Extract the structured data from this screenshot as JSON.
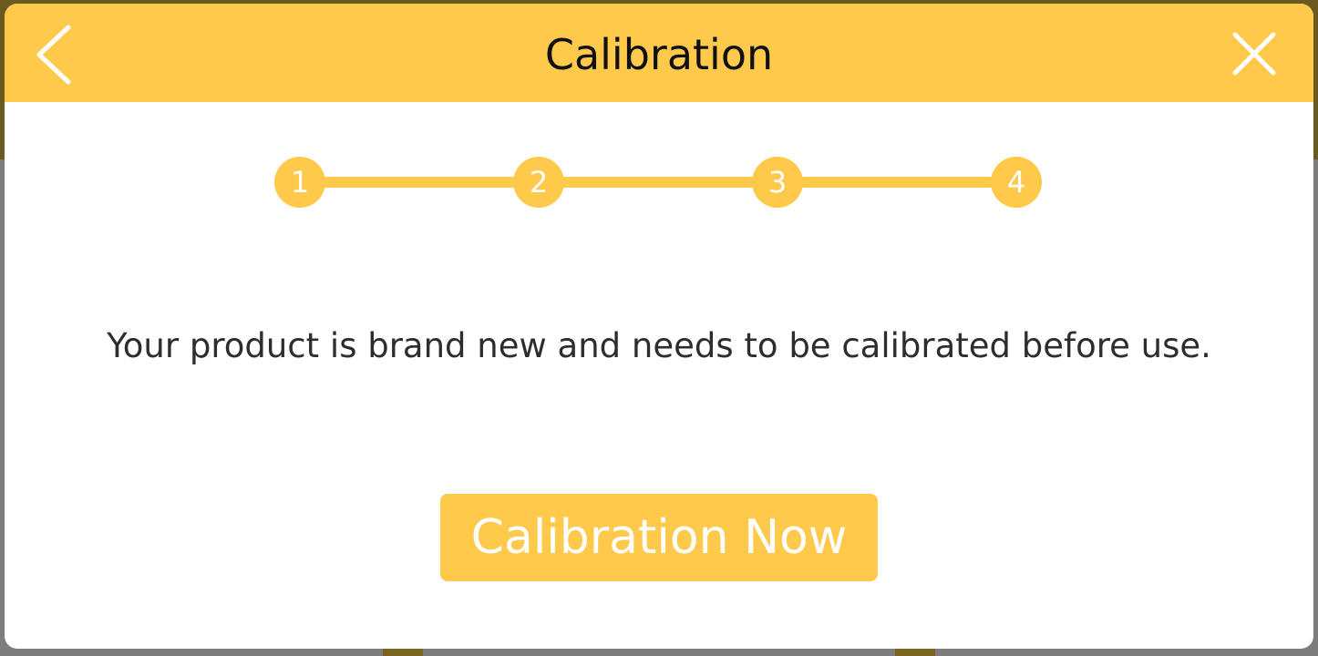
{
  "dialog": {
    "title": "Calibration",
    "back_icon": "chevron-left-icon",
    "close_icon": "close-icon",
    "steps": [
      "1",
      "2",
      "3",
      "4"
    ],
    "message": "Your product is brand new and needs to be calibrated before use.",
    "cta_label": "Calibration Now"
  },
  "colors": {
    "accent": "#ffc94c",
    "text": "#2d2d2d",
    "title": "#111111",
    "surface": "#ffffff"
  }
}
